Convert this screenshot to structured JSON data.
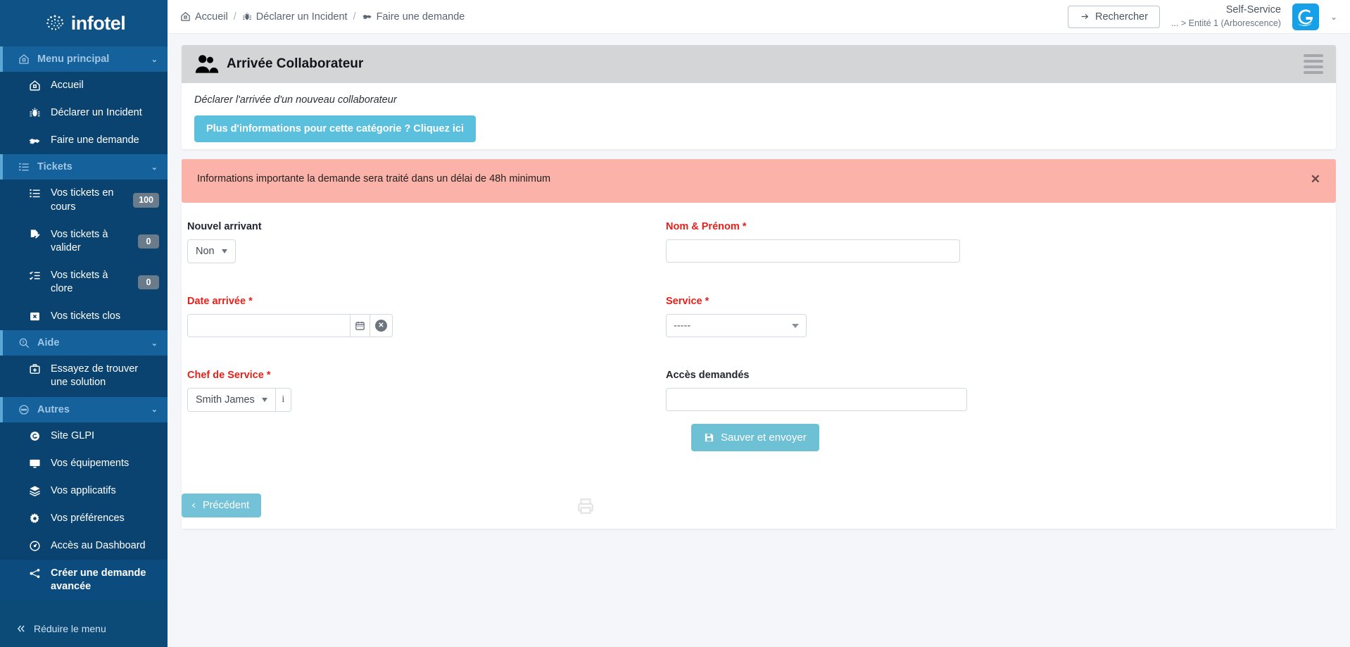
{
  "brand": {
    "name": "infotel",
    "logo_icon": "infotel-spiral-logo"
  },
  "sidebar": {
    "sections": [
      {
        "header": {
          "label": "Menu principal",
          "icon": "home-icon"
        },
        "items": [
          {
            "label": "Accueil",
            "icon": "home-icon",
            "badge": null,
            "active": false
          },
          {
            "label": "Déclarer un Incident",
            "icon": "bug-icon",
            "badge": null,
            "active": false
          },
          {
            "label": "Faire une demande",
            "icon": "hands-help-icon",
            "badge": null,
            "active": false
          }
        ]
      },
      {
        "header": {
          "label": "Tickets",
          "icon": "list-icon"
        },
        "items": [
          {
            "label": "Vos tickets en cours",
            "icon": "list-icon",
            "badge": "100",
            "active": false
          },
          {
            "label": "Vos tickets à valider",
            "icon": "file-edit-icon",
            "badge": "0",
            "active": false
          },
          {
            "label": "Vos tickets à clore",
            "icon": "list-check-icon",
            "badge": "0",
            "active": false
          },
          {
            "label": "Vos tickets clos",
            "icon": "box-x-icon",
            "badge": null,
            "active": false
          }
        ]
      },
      {
        "header": {
          "label": "Aide",
          "icon": "search-question-icon"
        },
        "items": [
          {
            "label": "Essayez de trouver une solution",
            "icon": "first-aid-kit-icon",
            "badge": null,
            "active": false
          }
        ]
      },
      {
        "header": {
          "label": "Autres",
          "icon": "dots-circle-icon"
        },
        "items": [
          {
            "label": "Site GLPI",
            "icon": "glpi-circle-icon",
            "badge": null,
            "active": false
          },
          {
            "label": "Vos équipements",
            "icon": "monitor-icon",
            "badge": null,
            "active": false
          },
          {
            "label": "Vos applicatifs",
            "icon": "layers-icon",
            "badge": null,
            "active": false
          },
          {
            "label": "Vos préférences",
            "icon": "gear-icon",
            "badge": null,
            "active": false
          },
          {
            "label": "Accès au Dashboard",
            "icon": "gauge-circle-icon",
            "badge": null,
            "active": false
          },
          {
            "label": "Créer une demande avancée",
            "icon": "share-nodes-icon",
            "badge": null,
            "active": true
          }
        ]
      }
    ],
    "collapse": {
      "label": "Réduire le menu",
      "icon": "double-chevron-left-icon"
    }
  },
  "topbar": {
    "breadcrumb": [
      {
        "label": "Accueil",
        "icon": "home-icon"
      },
      {
        "label": "Déclarer un Incident",
        "icon": "bug-icon"
      },
      {
        "label": "Faire une demande",
        "icon": "hands-help-icon"
      }
    ],
    "separator": "/",
    "search_button": {
      "label": "Rechercher",
      "icon": "arrow-right-icon"
    },
    "profile": {
      "name": "Self-Service",
      "entity": "... > Entité 1 (Arborescence)",
      "avatar_letter": "G"
    }
  },
  "page": {
    "title": "Arrivée Collaborateur",
    "title_icon": "users-icon",
    "menu_icon": "hamburger-icon",
    "subtitle": "Déclarer l'arrivée d'un nouveau collaborateur",
    "info_button": "Plus d'informations pour cette catégorie ? Cliquez ici",
    "alert": {
      "text": "Informations importante  la demande sera traité dans un délai de 48h minimum",
      "close_icon": "close-icon",
      "background": "#fbb2a8"
    }
  },
  "form": {
    "fields": {
      "nouvel_arrivant": {
        "label": "Nouvel arrivant",
        "required": false,
        "value": "Non"
      },
      "nom_prenom": {
        "label": "Nom & Prénom",
        "required": true,
        "value": "",
        "placeholder": ""
      },
      "date_arrivee": {
        "label": "Date arrivée",
        "required": true,
        "value": "",
        "placeholder": "",
        "calendar_icon": "calendar-icon",
        "clear_icon": "clear-circle-icon"
      },
      "service": {
        "label": "Service",
        "required": true,
        "value": "-----"
      },
      "chef_de_service": {
        "label": "Chef de Service",
        "required": true,
        "value": "Smith James",
        "info_icon": "info-icon"
      },
      "acces_demandes": {
        "label": "Accès demandés",
        "required": false,
        "value": "",
        "placeholder": ""
      }
    },
    "required_marker": "*",
    "submit_button": {
      "label": "Sauver et envoyer",
      "icon": "save-icon"
    }
  },
  "footer": {
    "back_button": {
      "label": "Précédent",
      "icon": "chevron-left-icon"
    },
    "print_icon": "printer-icon"
  },
  "colors": {
    "sidebar_bg": "#0c4a78",
    "sidebar_section": "#14619c",
    "accent_cyan": "#5bc0de",
    "submit_teal": "#6ec1d4",
    "alert_bg": "#fbb2a8",
    "required_red": "#e8201a",
    "avatar_blue": "#16a0e8"
  }
}
